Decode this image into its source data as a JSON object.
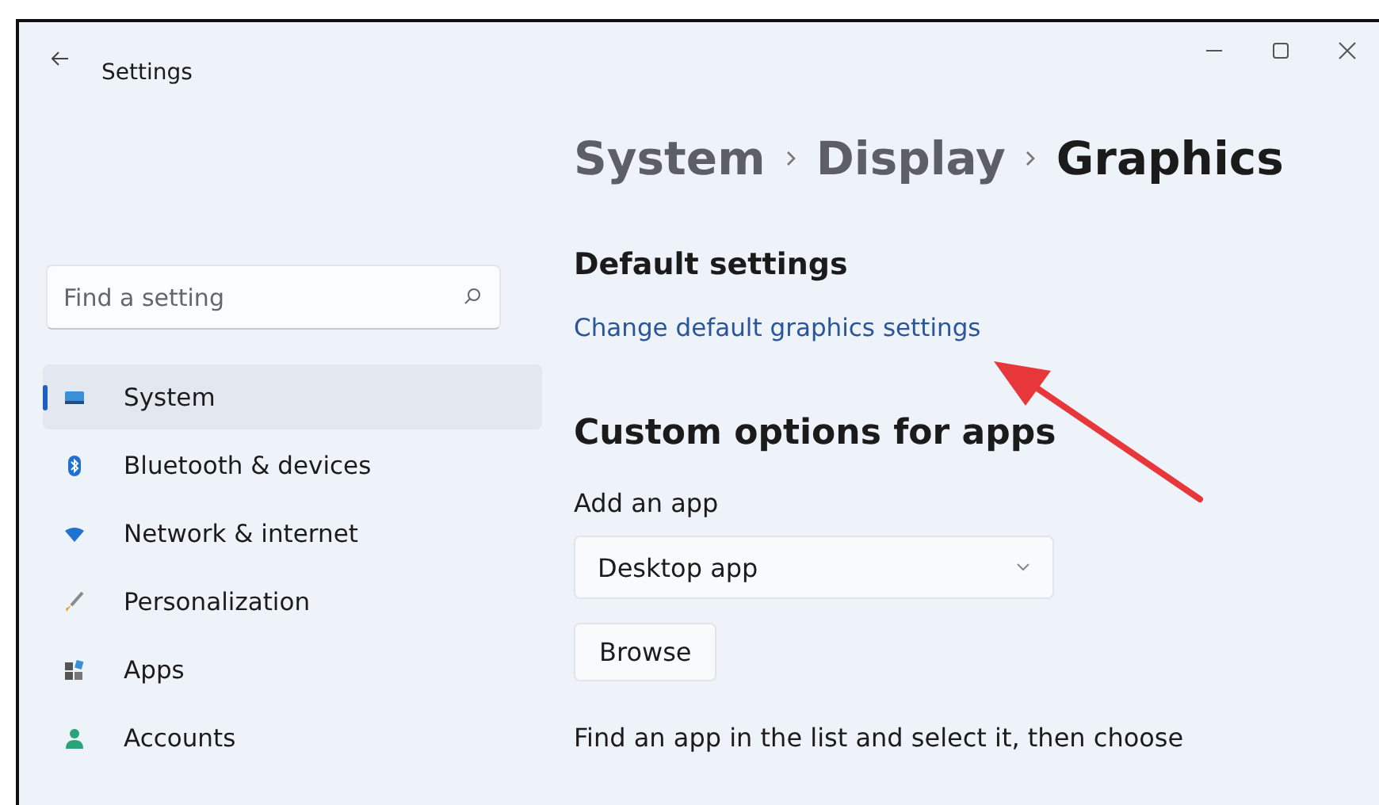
{
  "window": {
    "title": "Settings"
  },
  "breadcrumb": [
    "System",
    "Display",
    "Graphics"
  ],
  "search": {
    "placeholder": "Find a setting"
  },
  "sidebar": {
    "items": [
      {
        "label": "System",
        "selected": true
      },
      {
        "label": "Bluetooth & devices",
        "selected": false
      },
      {
        "label": "Network & internet",
        "selected": false
      },
      {
        "label": "Personalization",
        "selected": false
      },
      {
        "label": "Apps",
        "selected": false
      },
      {
        "label": "Accounts",
        "selected": false
      }
    ]
  },
  "content": {
    "default_heading": "Default settings",
    "default_link": "Change default graphics settings",
    "custom_heading": "Custom options for apps",
    "add_label": "Add an app",
    "app_type": {
      "value": "Desktop app"
    },
    "browse_button": "Browse",
    "description": "Find an app in the list and select it, then choose"
  }
}
